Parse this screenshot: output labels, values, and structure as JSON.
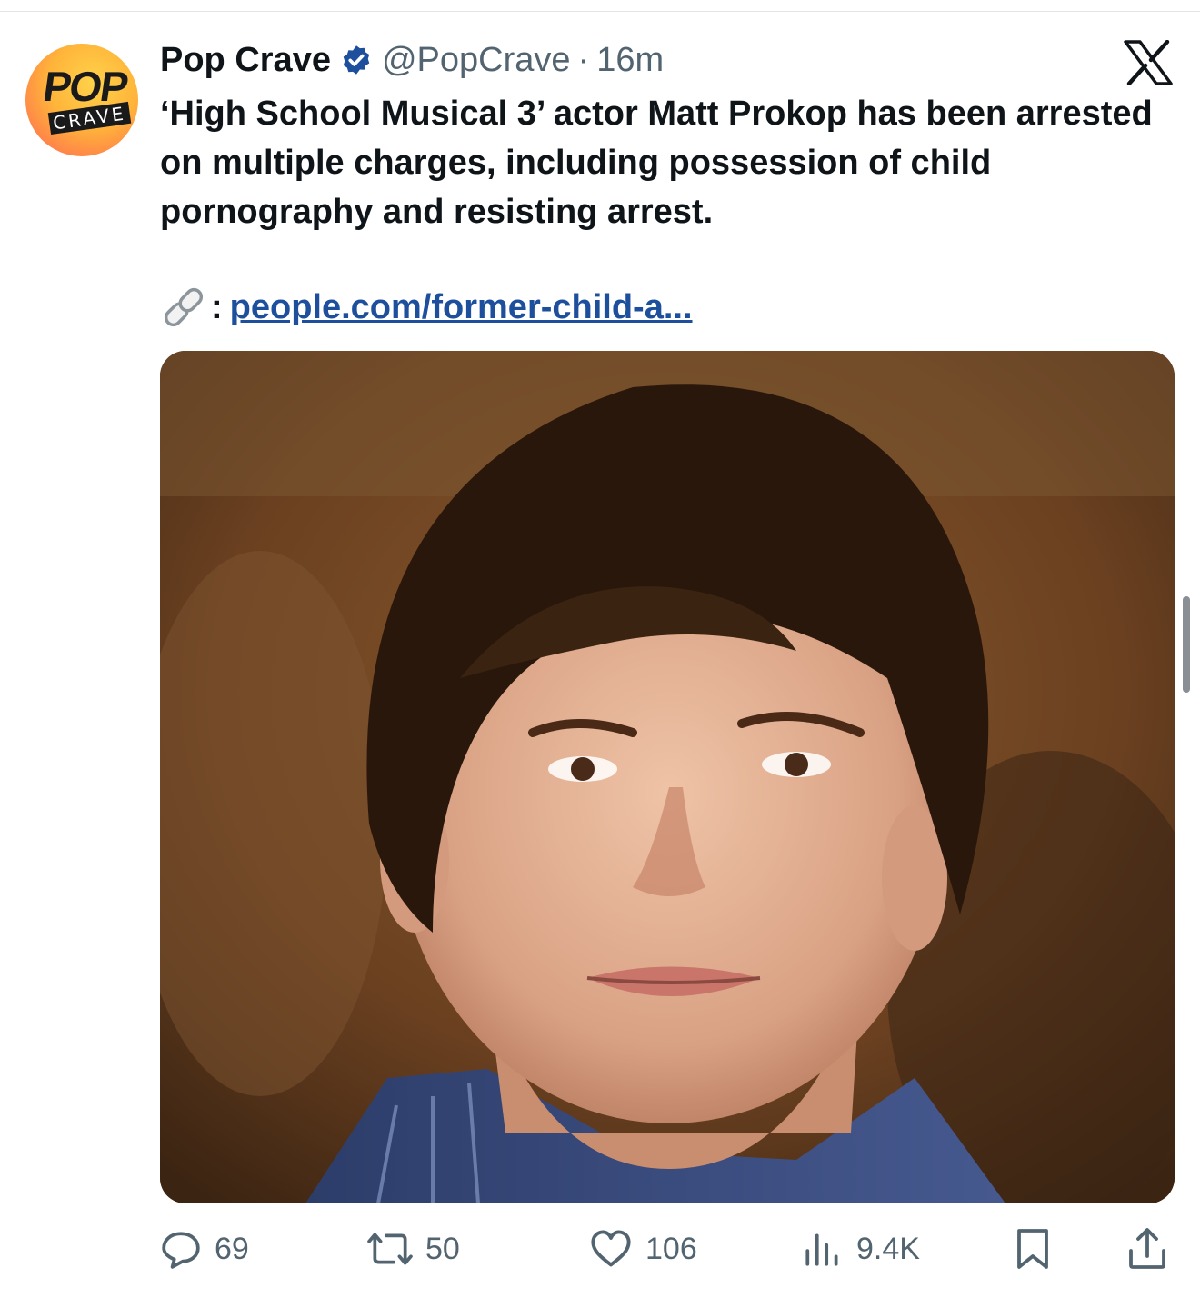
{
  "post": {
    "author_name": "Pop Crave",
    "handle": "@PopCrave",
    "separator": "·",
    "time": "16m",
    "avatar": {
      "line1": "POP",
      "line2": "CRAVE"
    },
    "verified_icon": "verified-badge-icon",
    "platform_icon": "x-logo-icon",
    "text": "‘High School Musical 3’ actor Matt Prokop has been arrested on multiple charges, including possession of child pornography and resisting arrest.",
    "link_colon": ":",
    "link_text": "people.com/former-child-a..."
  },
  "actions": {
    "replies": "69",
    "reposts": "50",
    "likes": "106",
    "views": "9.4K"
  },
  "colors": {
    "text_primary": "#0f1419",
    "text_secondary": "#536471",
    "link": "#1d4f9c",
    "verified": "#1d4f9c"
  }
}
